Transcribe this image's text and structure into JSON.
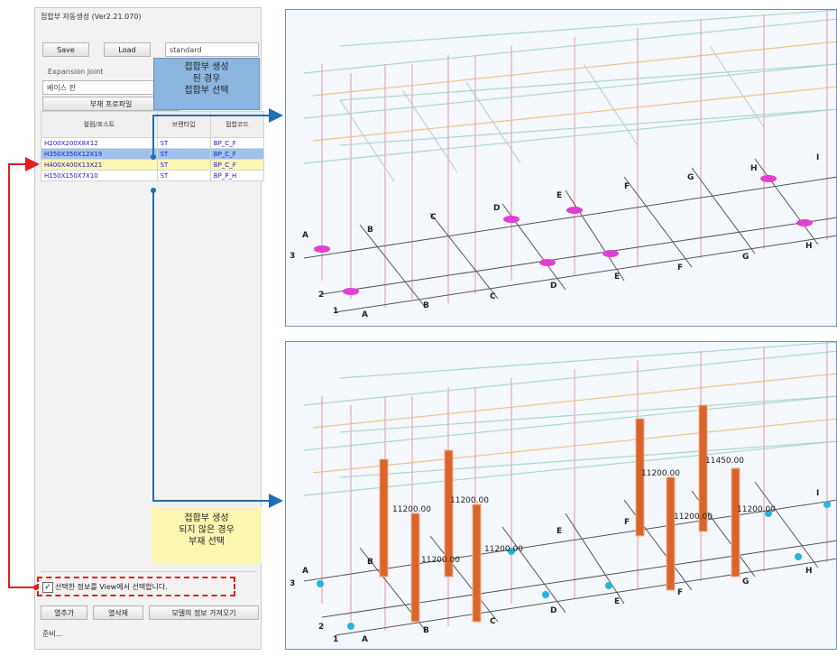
{
  "window": {
    "title": "접합부 자동생성 (Ver2.21.070)"
  },
  "toolbar": {
    "save_label": "Save",
    "load_label": "Load",
    "preset_value": "standard"
  },
  "expansion": {
    "label": "Expansion Joint",
    "value": "베이스 판"
  },
  "tab": {
    "label": "부재 프로파일"
  },
  "table": {
    "headers": [
      "컬럼/포스트",
      "브랜타입",
      "접합코드"
    ],
    "rows": [
      [
        "H200X200X8X12",
        "ST",
        "BP_C_F"
      ],
      [
        "H350X350X12X19",
        "ST",
        "BP_C_F"
      ],
      [
        "H400X400X13X21",
        "ST",
        "BP_C_F"
      ],
      [
        "H150X150X7X10",
        "ST",
        "BP_P_H"
      ]
    ]
  },
  "checkbox": {
    "label": "선택한 정보를 View에서 선택합니다."
  },
  "bottom_buttons": {
    "add_label": "열추가",
    "delete_label": "열삭제",
    "fetch_label": "모델의 정보 가져오기"
  },
  "footer": {
    "label": "준비..."
  },
  "callout_top": {
    "line1": "접합부 생성",
    "line2": "된 경우",
    "line3": "접합부 선택"
  },
  "callout_bottom": {
    "line1": "접합부 생성",
    "line2": "되지 않은 경우",
    "line3": "부재 선택"
  },
  "colors": {
    "connector_highlight": "#e040d0",
    "column_highlight": "#d9652b",
    "node_marker": "#28b4e0",
    "arrow_blue": "#1f6fb2",
    "arrow_red": "#e02020"
  },
  "view_top": {
    "grid_letters": [
      "A",
      "B",
      "C",
      "D",
      "E",
      "F",
      "G",
      "H",
      "I"
    ],
    "grid_numbers": [
      "3",
      "2",
      "1"
    ]
  },
  "view_bottom": {
    "dims": [
      "11200.00",
      "11200.00",
      "11200.00",
      "11200.00",
      "11200.00",
      "11200.00",
      "11450.00",
      "11200.00",
      "11200.00"
    ]
  }
}
